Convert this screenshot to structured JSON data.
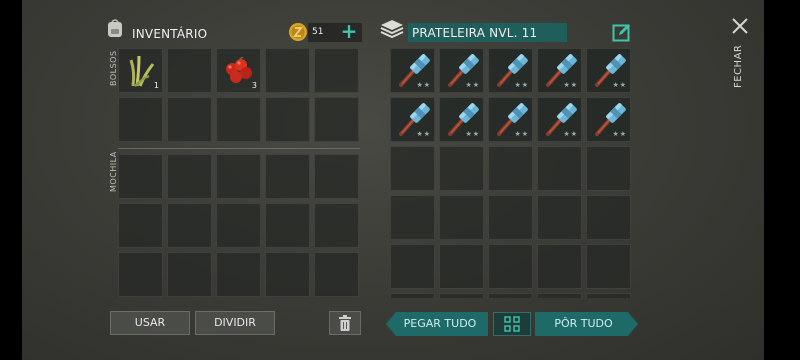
{
  "inventory": {
    "title": "INVENTÁRIO",
    "currency_amount": "51",
    "pockets_label": "BOLSOS",
    "backpack_label": "MOCHILA",
    "pockets_items": [
      {
        "icon": "wheat-icon",
        "count": "1"
      },
      {
        "icon": "berries-icon",
        "count": "3"
      }
    ]
  },
  "shelf": {
    "title": "PRATELEIRA NVL. 11",
    "items": [
      {
        "icon": "hammer-icon",
        "quality": "★★"
      },
      {
        "icon": "hammer-icon",
        "quality": "★★"
      },
      {
        "icon": "hammer-icon",
        "quality": "★★"
      },
      {
        "icon": "hammer-icon",
        "quality": "★★"
      },
      {
        "icon": "hammer-icon",
        "quality": "★★"
      },
      {
        "icon": "hammer-icon",
        "quality": "★★"
      },
      {
        "icon": "hammer-icon",
        "quality": "★★"
      },
      {
        "icon": "hammer-icon",
        "quality": "★★"
      },
      {
        "icon": "hammer-icon",
        "quality": "★★"
      },
      {
        "icon": "hammer-icon",
        "quality": "★★"
      }
    ]
  },
  "actions": {
    "use": "USAR",
    "split": "DIVIDIR",
    "take_all": "PEGAR TUDO",
    "put_all": "PÔR TUDO"
  },
  "close_label": "FECHAR",
  "colors": {
    "accent_teal": "#1e6a68",
    "shelf_title_bg": "#1f5e5a",
    "hammer_head": "#6cb6d8",
    "hammer_handle": "#8a3a2a"
  }
}
